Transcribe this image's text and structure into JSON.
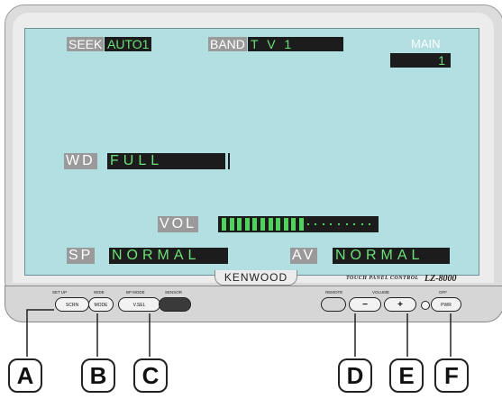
{
  "screen": {
    "seek": {
      "label": "SEEK",
      "value": "AUTO1"
    },
    "band": {
      "label": "BAND",
      "value": "T V 1"
    },
    "main": {
      "label": "MAIN",
      "value": "1"
    },
    "wide": {
      "label": "WD",
      "value": "FULL"
    },
    "volume": {
      "label": "VOL",
      "level_fraction": 0.55
    },
    "speaker": {
      "label": "SP",
      "value": "NORMAL"
    },
    "av": {
      "label": "AV",
      "value": "NORMAL"
    }
  },
  "brand": {
    "logo": "KENWOOD",
    "subtitle": "TOUCH PANEL CONTROL",
    "model": "LZ-8000"
  },
  "controls": {
    "scrn": {
      "label": "SCRN",
      "top": "SET UP"
    },
    "mode": {
      "label": "MODE",
      "top": "WIDE"
    },
    "vsel": {
      "label": "V.SEL",
      "top": "BP MODE"
    },
    "sensor": {
      "top": "SENSOR"
    },
    "remote": {
      "top": "REMOTE"
    },
    "vol_down": {
      "label": "−"
    },
    "vol_up": {
      "label": "+"
    },
    "volume_label": "VOLUME",
    "pwr": {
      "label": "PWR",
      "top": "OFF"
    }
  },
  "callouts": [
    "A",
    "B",
    "C",
    "D",
    "E",
    "F"
  ],
  "colors": {
    "screen": "#b2dfe2",
    "value_text": "#6ee07a",
    "value_bg": "#1c1c1c",
    "label_bg": "#9a9a9a"
  }
}
